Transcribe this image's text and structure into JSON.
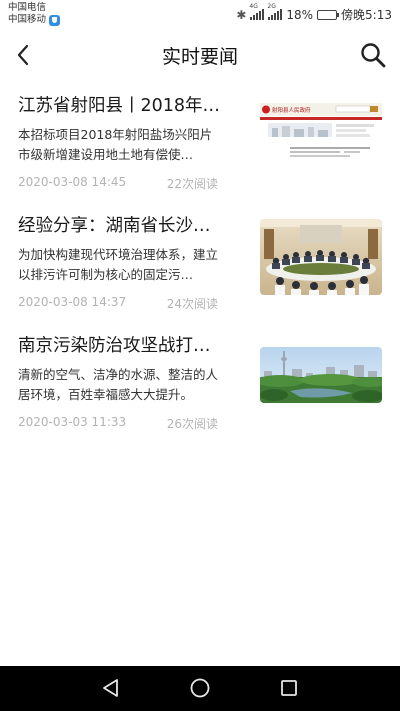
{
  "status_bar": {
    "carrier_1": "中国电信",
    "carrier_2": "中国移动",
    "network_1": "4G",
    "network_2": "2G",
    "battery_text": "18%",
    "battery_level": 0.18,
    "time": "傍晚5:13"
  },
  "header": {
    "title": "实时要闻"
  },
  "news": [
    {
      "title": "江苏省射阳县丨2018年…",
      "desc": "本招标项目2018年射阳盐场兴阳片市级新增建设用地土地有偿使…",
      "date": "2020-03-08 14:45",
      "reads": "22次阅读",
      "thumb_header": "射阳县人民政府"
    },
    {
      "title": "经验分享：湖南省长沙…",
      "desc": "为加快构建现代环境治理体系，建立以排污许可制为核心的固定污…",
      "date": "2020-03-08 14:37",
      "reads": "24次阅读"
    },
    {
      "title": "南京污染防治攻坚战打…",
      "desc": "清新的空气、洁净的水源、整洁的人居环境，百姓幸福感大大提升。",
      "date": "2020-03-03 11:33",
      "reads": "26次阅读"
    }
  ],
  "colors": {
    "meta_gray": "#b3b3b3",
    "nav_background": "#000000"
  },
  "icons": {
    "back": "back-arrow-icon",
    "search": "search-icon",
    "nav_back": "nav-back-icon",
    "nav_home": "nav-home-icon",
    "nav_recents": "nav-recents-icon"
  }
}
